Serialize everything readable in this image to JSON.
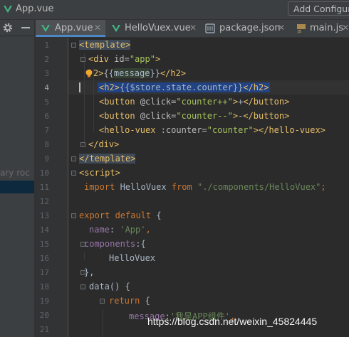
{
  "window": {
    "title": "App.vue",
    "config_button": "Add Configur"
  },
  "side_panel": {
    "fragment_text": "ary roc"
  },
  "tabs": [
    {
      "label": "App.vue",
      "icon": "vue-icon",
      "active": true
    },
    {
      "label": "HelloVuex.vue",
      "icon": "vue-icon",
      "active": false
    },
    {
      "label": "package.json",
      "icon": "json-icon",
      "active": false
    },
    {
      "label": "main.js",
      "icon": "js-icon",
      "active": false
    }
  ],
  "editor": {
    "current_line": 4,
    "line_numbers": [
      "1",
      "2",
      "3",
      "4",
      "5",
      "6",
      "7",
      "8",
      "9",
      "10",
      "11",
      "12",
      "13",
      "14",
      "15",
      "16",
      "17",
      "18",
      "19",
      "20",
      "21"
    ],
    "lines": [
      "<template>",
      "  <div id=\"app\">",
      "    <h2>{{message}}</h2>",
      "    <h2>{{$store.state.counter}}</h2>",
      "    <button @click=\"counter++\">+</button>",
      "    <button @click=\"counter--\">-</button>",
      "    <hello-vuex :counter=\"counter\"></hello-vuex>",
      "  </div>",
      "</template>",
      "<script>",
      "  import HelloVuex from \"./components/HelloVuex\";",
      "",
      "export default {",
      "  name: 'App',",
      "  components:{",
      "      HelloVuex",
      "  },",
      "  data() {",
      "      return {",
      "          message:'我是APP组件',",
      ""
    ],
    "tokens": {
      "l1_tag": "<template>",
      "l2_open": "<div ",
      "l2_attr": "id=",
      "l2_val": "\"app\"",
      "l2_close": ">",
      "l3_bulb_tail": "2>",
      "l3_open": "{{",
      "l3_expr": "message",
      "l3_close": "}}",
      "l3_end": "</h2>",
      "l4_open": "<h2>",
      "l4_expr": "{{$store.state.counter}}",
      "l4_end": "</h2>",
      "l5_open": "<button ",
      "l5_attr": "@click=",
      "l5_val": "\"counter++\"",
      "l5_close": ">",
      "l5_text": "+",
      "l5_end": "</button>",
      "l6_open": "<button ",
      "l6_attr": "@click=",
      "l6_val": "\"counter--\"",
      "l6_close": ">",
      "l6_text": "-",
      "l6_end": "</button>",
      "l7_open": "<hello-vuex ",
      "l7_attr": ":counter=",
      "l7_val": "\"counter\"",
      "l7_close": "></hello-vuex>",
      "l8": "</div>",
      "l9": "</template>",
      "l10": "<script>",
      "l11_kw": "import",
      "l11_id": " HelloVuex ",
      "l11_from": "from",
      "l11_str": " \"./components/HelloVuex\"",
      "l11_semi": ";",
      "l13_kw": "export default",
      "l13_brace": " {",
      "l14_key": "name",
      "l14_colon": ": ",
      "l14_str": "'App'",
      "l14_comma": ",",
      "l15_key": "components",
      "l15_rest": ":{",
      "l16": "HelloVuex",
      "l17": "},",
      "l18": "data() {",
      "l19_kw": "return",
      "l19_brace": " {",
      "l20_key": "message",
      "l20_colon": ":",
      "l20_str": "'我是APP组件'",
      "l20_comma": ","
    }
  },
  "watermark": "https://blog.csdn.net/weixin_45824445",
  "colors": {
    "background": "#2b2b2b",
    "tag": "#e8bf6a",
    "keyword": "#cc7832",
    "string": "#6a8759",
    "property": "#9876aa",
    "selection": "#214283"
  }
}
